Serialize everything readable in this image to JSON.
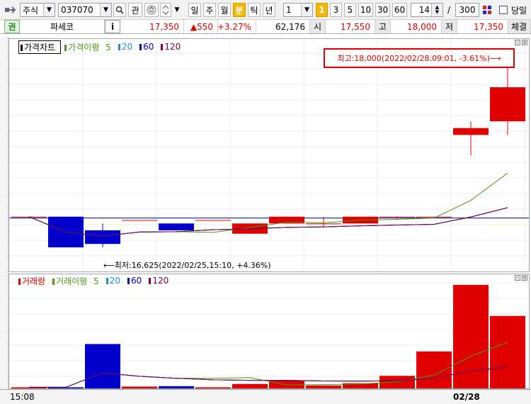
{
  "toolbar": {
    "market_select": "주식",
    "stock_code": "037070",
    "btn_gwan": "관",
    "periods": [
      "일",
      "주",
      "월",
      "분",
      "틱",
      "년"
    ],
    "period_selected": "분",
    "interval_value": "1",
    "interval_badge": "1",
    "intervals": [
      "3",
      "5",
      "10",
      "30",
      "60"
    ],
    "count_value": "14",
    "count_sep": "/",
    "count_max": "300",
    "same_day_label": "당일"
  },
  "quote": {
    "tag": "권",
    "name": "파세코",
    "info_btn": "i",
    "price": "17,350",
    "change": "▲550",
    "change_pct": "+3.27%",
    "volume": "62,176",
    "open_label": "시",
    "open": "17,550",
    "high_label": "고",
    "high": "18,000",
    "low_label": "저",
    "low": "17,350",
    "trade_label": "체결"
  },
  "price_panel": {
    "legend_title": "가격차트",
    "ma_label": "가격이평",
    "ma_periods": [
      "5",
      "20",
      "60",
      "120"
    ],
    "max_label": "최고:18,000(2022/02/28,09:01, -3.61%)",
    "min_label": "최저:16,625(2022/02/25,15:10, +4.36%)"
  },
  "volume_panel": {
    "legend_title": "거래량",
    "ma_label": "거래이평",
    "ma_periods": [
      "5",
      "20",
      "60",
      "120"
    ]
  },
  "x_axis": {
    "left_label": "15:08",
    "date_label": "02/28"
  },
  "colors": {
    "up": "#e00000",
    "down": "#0000cc",
    "ma5": "#4a9a10",
    "ma20": "#2090d8",
    "ma60": "#0000aa",
    "ma120": "#800040"
  },
  "chart_data": {
    "type": "candlestick",
    "candles": [
      {
        "open": 16850,
        "high": 16850,
        "low": 16850,
        "close": 16850
      },
      {
        "open": 16850,
        "high": 16850,
        "low": 16625,
        "close": 16625
      },
      {
        "open": 16750,
        "high": 16800,
        "low": 16625,
        "close": 16650
      },
      {
        "open": 16825,
        "high": 16825,
        "low": 16825,
        "close": 16825
      },
      {
        "open": 16800,
        "high": 16800,
        "low": 16750,
        "close": 16750
      },
      {
        "open": 16825,
        "high": 16825,
        "low": 16825,
        "close": 16825
      },
      {
        "open": 16725,
        "high": 16800,
        "low": 16725,
        "close": 16800
      },
      {
        "open": 16800,
        "high": 16850,
        "low": 16800,
        "close": 16850
      },
      {
        "open": 16800,
        "high": 16850,
        "low": 16775,
        "close": 16800
      },
      {
        "open": 16800,
        "high": 16850,
        "low": 16800,
        "close": 16850
      },
      {
        "open": 16850,
        "high": 16850,
        "low": 16825,
        "close": 16850
      },
      {
        "open": 16850,
        "high": 16850,
        "low": 16850,
        "close": 16850
      },
      {
        "open": 17450,
        "high": 17550,
        "low": 17300,
        "close": 17500
      },
      {
        "open": 17550,
        "high": 18000,
        "low": 17450,
        "close": 17800
      }
    ],
    "volumes": [
      150,
      150,
      6000,
      250,
      300,
      150,
      600,
      1100,
      400,
      700,
      1700,
      5000,
      14000,
      9800
    ],
    "ylim": [
      16500,
      18050
    ]
  }
}
